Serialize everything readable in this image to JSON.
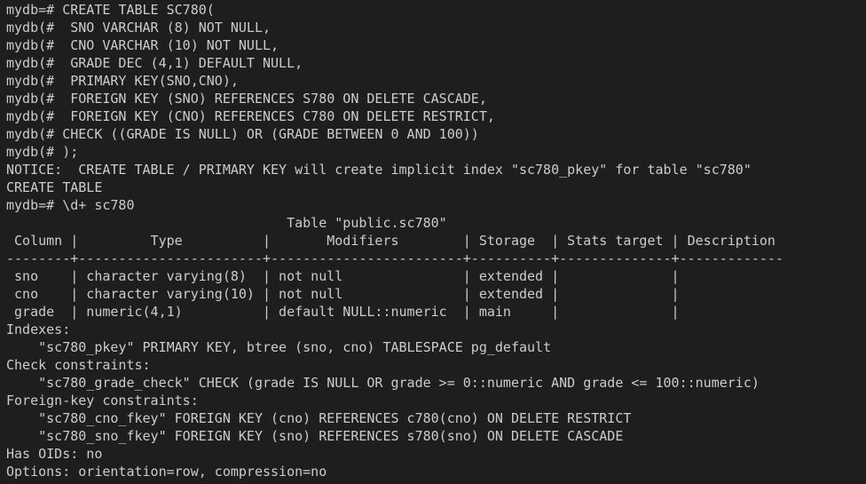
{
  "terminal": {
    "lines": [
      "mydb=# CREATE TABLE SC780(",
      "mydb(#  SNO VARCHAR (8) NOT NULL,",
      "mydb(#  CNO VARCHAR (10) NOT NULL,",
      "mydb(#  GRADE DEC (4,1) DEFAULT NULL,",
      "mydb(#  PRIMARY KEY(SNO,CNO),",
      "mydb(#  FOREIGN KEY (SNO) REFERENCES S780 ON DELETE CASCADE,",
      "mydb(#  FOREIGN KEY (CNO) REFERENCES C780 ON DELETE RESTRICT,",
      "mydb(# CHECK ((GRADE IS NULL) OR (GRADE BETWEEN 0 AND 100))",
      "mydb(# );",
      "NOTICE:  CREATE TABLE / PRIMARY KEY will create implicit index \"sc780_pkey\" for table \"sc780\"",
      "CREATE TABLE",
      "mydb=# \\d+ sc780",
      "                                   Table \"public.sc780\"",
      " Column |         Type          |       Modifiers        | Storage  | Stats target | Description",
      "--------+-----------------------+------------------------+----------+--------------+-------------",
      " sno    | character varying(8)  | not null               | extended |              |",
      " cno    | character varying(10) | not null               | extended |              |",
      " grade  | numeric(4,1)          | default NULL::numeric  | main     |              |",
      "Indexes:",
      "    \"sc780_pkey\" PRIMARY KEY, btree (sno, cno) TABLESPACE pg_default",
      "Check constraints:",
      "    \"sc780_grade_check\" CHECK (grade IS NULL OR grade >= 0::numeric AND grade <= 100::numeric)",
      "Foreign-key constraints:",
      "    \"sc780_cno_fkey\" FOREIGN KEY (cno) REFERENCES c780(cno) ON DELETE RESTRICT",
      "    \"sc780_sno_fkey\" FOREIGN KEY (sno) REFERENCES s780(sno) ON DELETE CASCADE",
      "Has OIDs: no",
      "Options: orientation=row, compression=no"
    ]
  }
}
